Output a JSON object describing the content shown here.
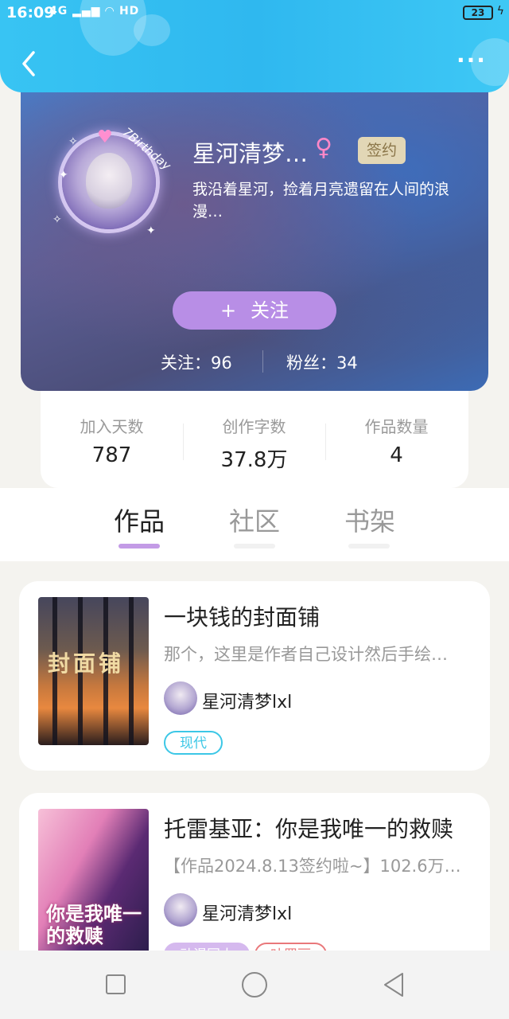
{
  "status_bar": {
    "time": "16:09",
    "signal": "4G",
    "wifi_label": "HD",
    "battery": "23"
  },
  "profile": {
    "avatar_text": "7Birthday",
    "nickname": "星河清梦…",
    "gender_symbol": "♀",
    "sign_badge": "签约",
    "bio": "我沿着星河，捡着月亮遗留在人间的浪漫…",
    "follow_plus": "+",
    "follow_label": "关注",
    "following": "关注：96",
    "fans": "粉丝：34"
  },
  "stats": [
    {
      "label": "加入天数",
      "value": "787"
    },
    {
      "label": "创作字数",
      "value": "37.8万"
    },
    {
      "label": "作品数量",
      "value": "4"
    }
  ],
  "tabs": [
    {
      "label": "作品",
      "active": true
    },
    {
      "label": "社区",
      "active": false
    },
    {
      "label": "书架",
      "active": false
    }
  ],
  "works": [
    {
      "cover_text": "封面铺",
      "title": "一块钱的封面铺",
      "desc": "那个，这里是作者自己设计然后手绘…",
      "author": "星河清梦lxl",
      "tags": [
        "现代"
      ]
    },
    {
      "cover_text": "你是我唯一的救赎",
      "title": "托雷基亚：你是我唯一的救赎",
      "desc": "【作品2024.8.13签约啦~】102.6万…",
      "author": "星河清梦lxl",
      "tags": [
        "动漫同人",
        "叶罗丽"
      ]
    }
  ],
  "colors": {
    "header": "#38c4f3",
    "accent_purple": "#b88ee6",
    "tag_cyan": "#3cc7e6",
    "tag_red": "#e9787b"
  },
  "icons": {
    "back": "chevron-left-icon",
    "more": "more-dots-icon",
    "nav_recent": "square-icon",
    "nav_home": "circle-icon",
    "nav_back": "triangle-back-icon"
  }
}
